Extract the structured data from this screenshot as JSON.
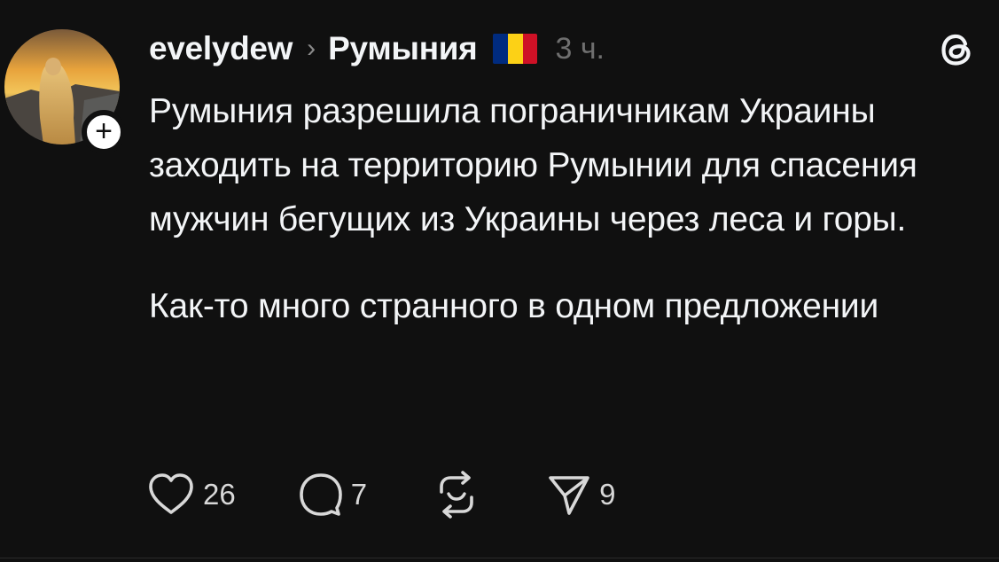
{
  "post": {
    "username": "evelydew",
    "separator": "›",
    "topic": "Румыния",
    "flag_colors": [
      "#002B7F",
      "#FCD116",
      "#CE1126"
    ],
    "time": "3 ч.",
    "paragraphs": [
      "Румыния разрешила пограничникам Украины заходить на территорию Румынии для спасения мужчин бегущих из Украины через леса и горы.",
      "Как-то много странного в одном предложении"
    ],
    "follow_symbol": "+",
    "actions": {
      "like_count": "26",
      "reply_count": "7",
      "share_count": "9"
    }
  },
  "colors": {
    "background": "#101010",
    "text": "#f3f5f7",
    "muted": "#6f6f6f"
  },
  "icons": {
    "app": "threads-logo-icon",
    "like": "heart-icon",
    "reply": "comment-bubble-icon",
    "repost": "repost-icon",
    "share": "send-icon"
  }
}
